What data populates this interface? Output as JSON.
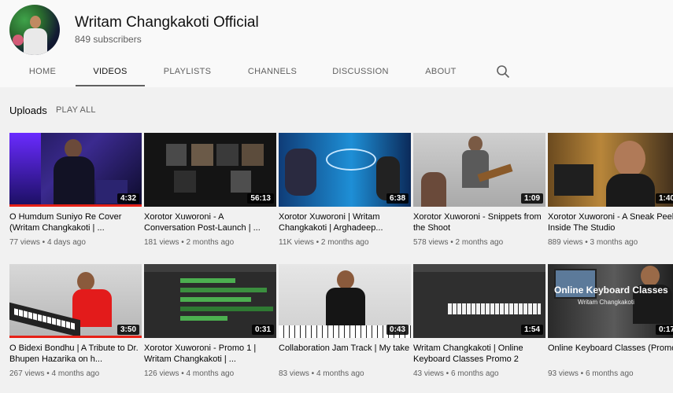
{
  "channel": {
    "name": "Writam Changkakoti Official",
    "subscribers": "849 subscribers"
  },
  "tabs": [
    "HOME",
    "VIDEOS",
    "PLAYLISTS",
    "CHANNELS",
    "DISCUSSION",
    "ABOUT"
  ],
  "active_tab": "VIDEOS",
  "section": {
    "title": "Uploads",
    "play_all": "PLAY ALL"
  },
  "colors": {
    "progress": "#e62117",
    "duration_bg": "#000000"
  },
  "videos": [
    {
      "title": "O Humdum Suniyo Re Cover (Writam Changkakoti | ...",
      "views": "77 views",
      "age": "4 days ago",
      "duration": "4:32"
    },
    {
      "title": "Xorotor Xuworoni - A Conversation Post-Launch | ...",
      "views": "181 views",
      "age": "2 months ago",
      "duration": "56:13"
    },
    {
      "title": "Xorotor Xuworoni | Writam Changkakoti | Arghadeep...",
      "views": "11K views",
      "age": "2 months ago",
      "duration": "6:38"
    },
    {
      "title": "Xorotor Xuworoni - Snippets from the Shoot",
      "views": "578 views",
      "age": "2 months ago",
      "duration": "1:09"
    },
    {
      "title": "Xorotor Xuworoni - A Sneak Peek Inside The Studio",
      "views": "889 views",
      "age": "3 months ago",
      "duration": "1:40"
    },
    {
      "title": "O Bidexi Bondhu | A Tribute to Dr. Bhupen Hazarika on h...",
      "views": "267 views",
      "age": "4 months ago",
      "duration": "3:50"
    },
    {
      "title": "Xorotor Xuworoni - Promo 1 | Writam Changkakoti | ...",
      "views": "126 views",
      "age": "4 months ago",
      "duration": "0:31"
    },
    {
      "title": "Collaboration Jam Track | My take",
      "views": "83 views",
      "age": "4 months ago",
      "duration": "0:43"
    },
    {
      "title": "Writam Changkakoti | Online Keyboard Classes Promo 2",
      "views": "43 views",
      "age": "6 months ago",
      "duration": "1:54"
    },
    {
      "title": "Online Keyboard Classes (Promo)",
      "views": "93 views",
      "age": "6 months ago",
      "duration": "0:17"
    }
  ],
  "thumb_text": {
    "keyboard_caption": "Online Keyboard Classes",
    "keyboard_subcaption": "Writam Changkakoti"
  }
}
